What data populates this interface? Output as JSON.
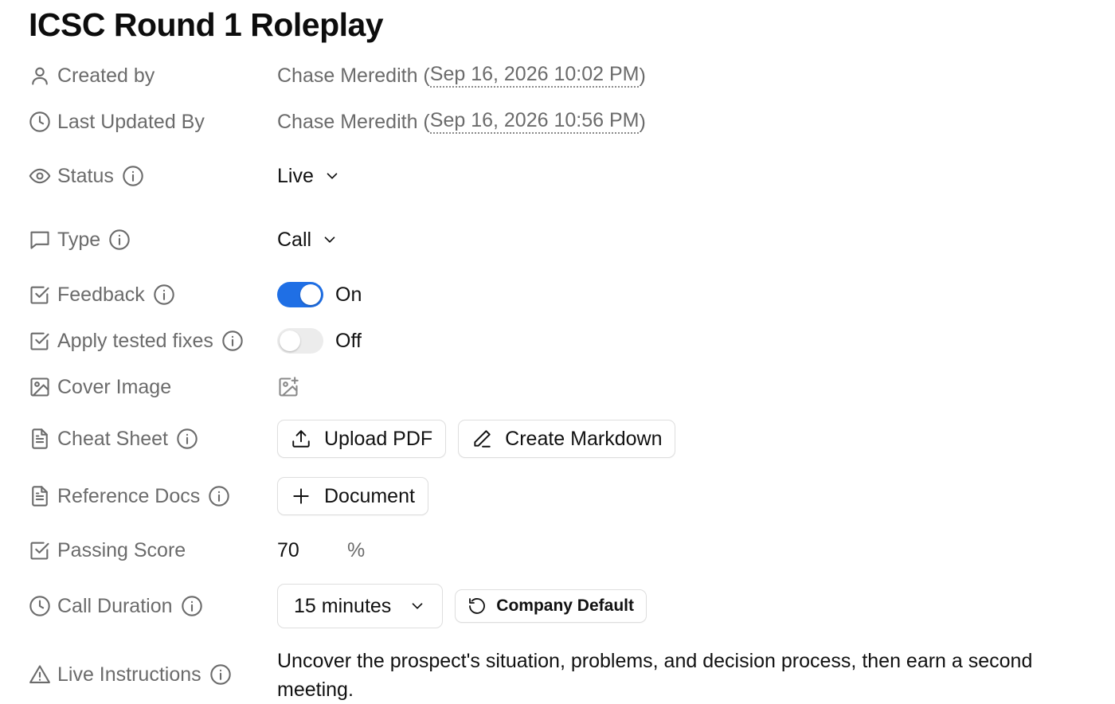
{
  "page": {
    "title": "ICSC Round 1 Roleplay"
  },
  "fields": {
    "created_by": {
      "label": "Created by",
      "icon": "user-icon",
      "name": "Chase Meredith",
      "open": " (",
      "timestamp": "Sep 16, 2026 10:02 PM",
      "close": ")"
    },
    "last_updated_by": {
      "label": "Last Updated By",
      "icon": "clock-icon",
      "name": "Chase Meredith",
      "open": " (",
      "timestamp": "Sep 16, 2026 10:56 PM",
      "close": ")"
    },
    "status": {
      "label": "Status",
      "icon": "eye-icon",
      "value": "Live"
    },
    "type": {
      "label": "Type",
      "icon": "message-square-icon",
      "value": "Call"
    },
    "feedback": {
      "label": "Feedback",
      "icon": "checkbox-icon",
      "state": "On",
      "enabled": true
    },
    "apply_tested_fixes": {
      "label": "Apply tested fixes",
      "icon": "checkbox-icon",
      "state": "Off",
      "enabled": false
    },
    "cover_image": {
      "label": "Cover Image",
      "icon": "image-icon",
      "action_icon": "image-plus-icon"
    },
    "cheat_sheet": {
      "label": "Cheat Sheet",
      "icon": "file-text-icon",
      "upload_label": "Upload PDF",
      "markdown_label": "Create Markdown"
    },
    "reference_docs": {
      "label": "Reference Docs",
      "icon": "file-text-icon",
      "add_label": "Document"
    },
    "passing_score": {
      "label": "Passing Score",
      "icon": "checkbox-icon",
      "value": "70",
      "unit": "%"
    },
    "call_duration": {
      "label": "Call Duration",
      "icon": "clock-icon",
      "value": "15 minutes",
      "reset_label": "Company Default"
    },
    "live_instructions": {
      "label": "Live Instructions",
      "icon": "alert-triangle-icon",
      "text": "Uncover the prospect's situation, problems, and decision process, then earn a second meeting."
    }
  },
  "colors": {
    "accent": "#1f6fe5",
    "label": "#6b6b6b",
    "text": "#111111",
    "border": "#dedede"
  }
}
